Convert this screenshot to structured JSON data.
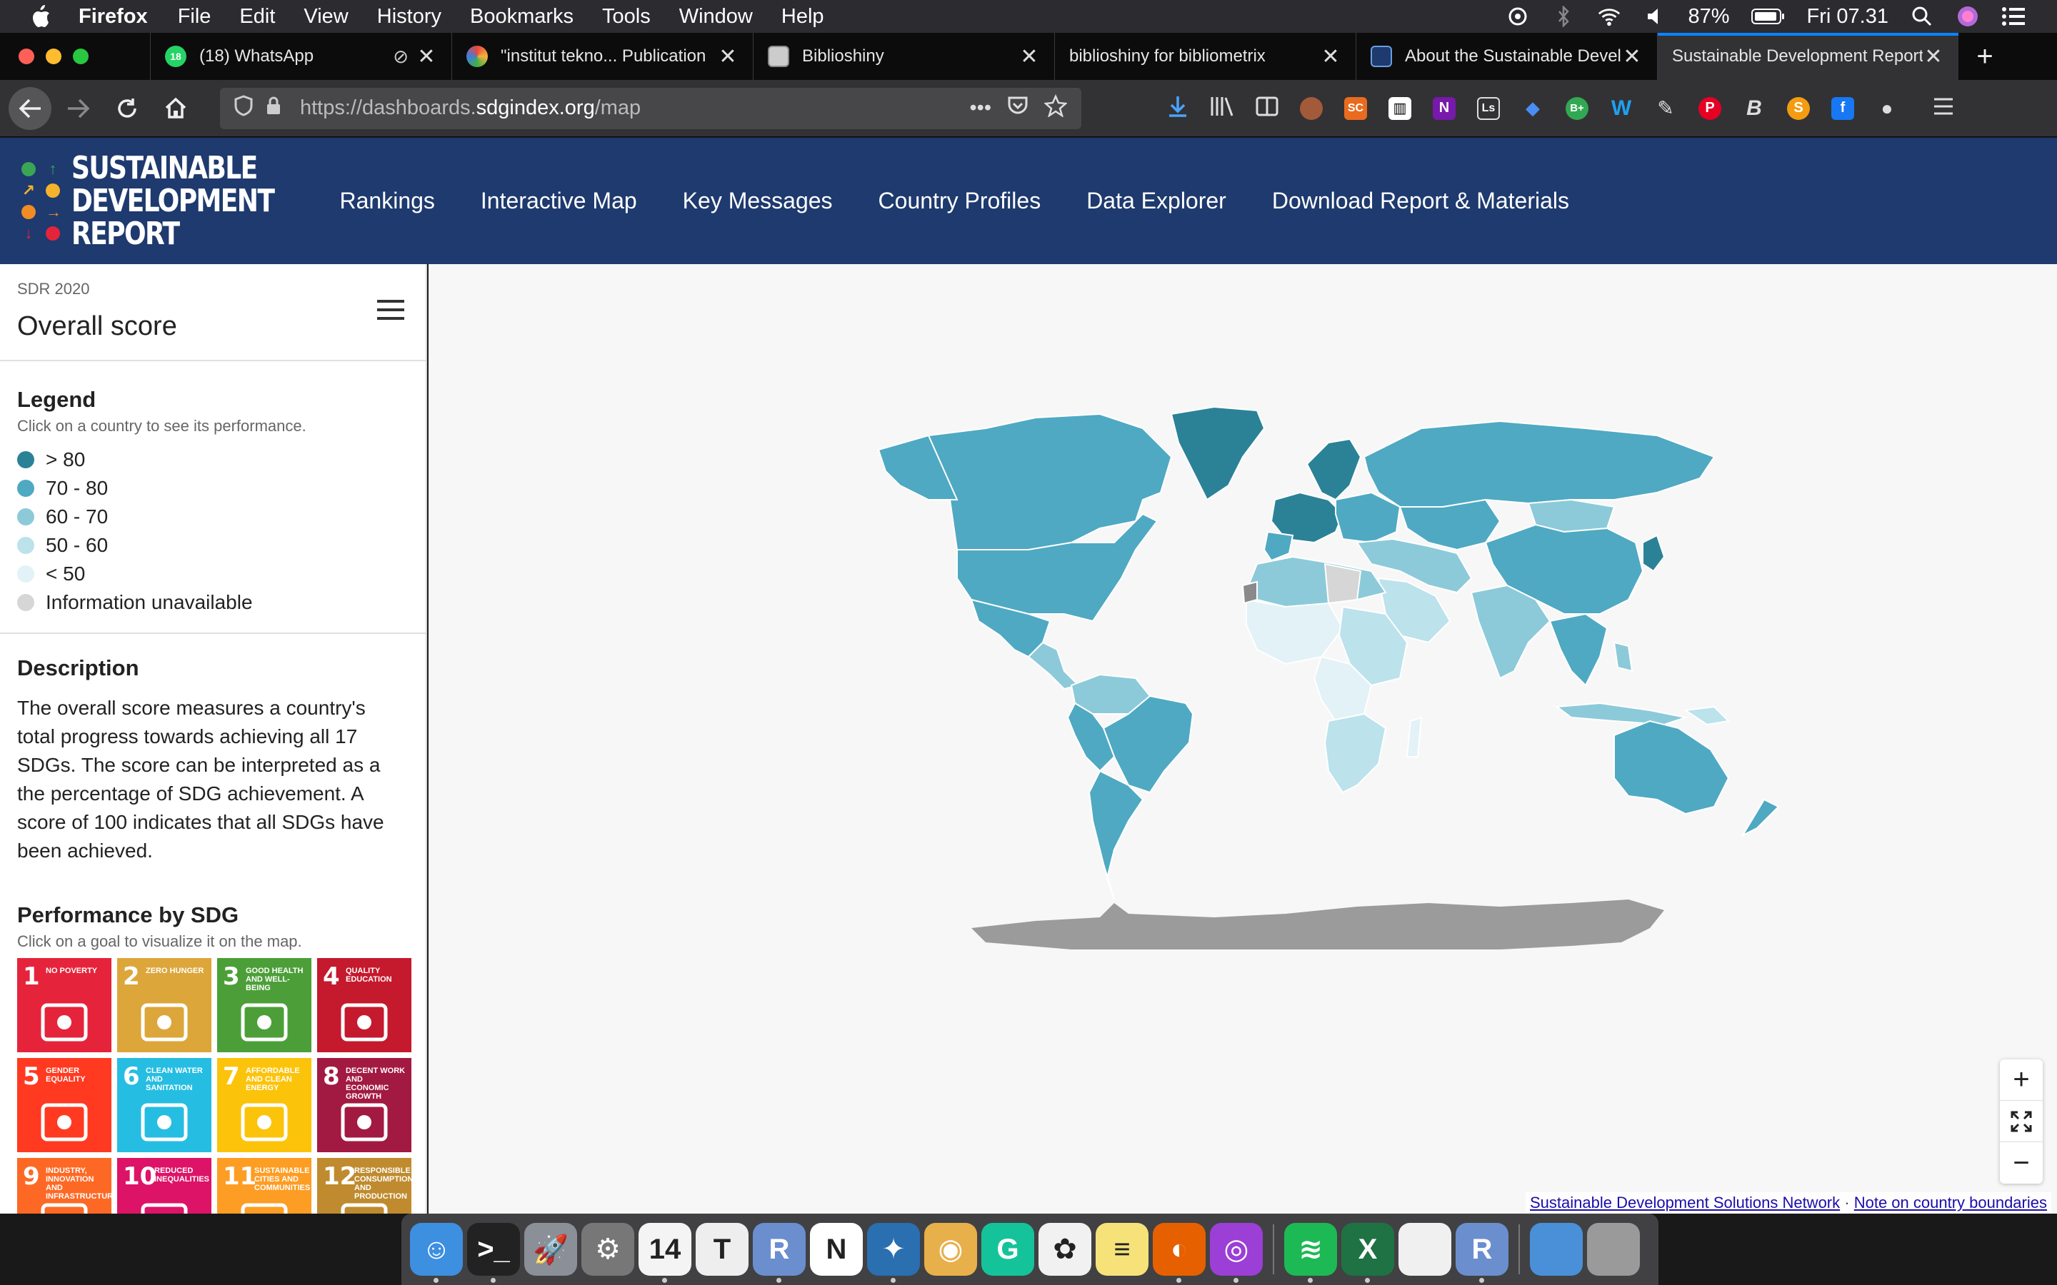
{
  "menubar": {
    "app": "Firefox",
    "items": [
      "File",
      "Edit",
      "View",
      "History",
      "Bookmarks",
      "Tools",
      "Window",
      "Help"
    ],
    "battery": "87%",
    "clock": "Fri 07.31"
  },
  "tabs": [
    {
      "title": "(18) WhatsApp",
      "icon": "whatsapp-icon",
      "badge": "18"
    },
    {
      "title": "\"institut tekno... Publication",
      "icon": "dimensions-icon"
    },
    {
      "title": "Biblioshiny",
      "icon": "biblioshiny-icon"
    },
    {
      "title": "biblioshiny for bibliometrix",
      "icon": ""
    },
    {
      "title": "About the Sustainable Development",
      "icon": "sdr-icon"
    },
    {
      "title": "Sustainable Development Report",
      "icon": ""
    }
  ],
  "toolbar": {
    "url_prefix": "https://dashboards.",
    "url_domain": "sdgindex.org",
    "url_path": "/map",
    "more_label": "•••"
  },
  "site": {
    "logo_lines": [
      "SUSTAINABLE",
      "DEVELOPMENT",
      "REPORT"
    ],
    "nav": [
      "Rankings",
      "Interactive Map",
      "Key Messages",
      "Country Profiles",
      "Data Explorer",
      "Download Report & Materials"
    ]
  },
  "sidebar": {
    "edition": "SDR 2020",
    "title": "Overall score",
    "legend_title": "Legend",
    "legend_hint": "Click on a country to see its performance.",
    "legend": [
      {
        "label": "> 80",
        "color": "#2b8296"
      },
      {
        "label": "70 - 80",
        "color": "#4fa9c2"
      },
      {
        "label": "60 - 70",
        "color": "#8ccad9"
      },
      {
        "label": "50 - 60",
        "color": "#bce2ec"
      },
      {
        "label": "< 50",
        "color": "#e2f2f7"
      },
      {
        "label": "Information unavailable",
        "color": "#d6d6d6"
      }
    ],
    "description_title": "Description",
    "description": "The overall score measures a country's total progress towards achieving all 17 SDGs. The score can be interpreted as a the percentage of SDG achievement. A score of 100 indicates that all SDGs have been achieved.",
    "perf_title": "Performance by SDG",
    "perf_hint": "Click on a goal to visualize it on the map.",
    "sdgs": [
      {
        "num": "1",
        "label": "NO POVERTY",
        "color": "#e5243b"
      },
      {
        "num": "2",
        "label": "ZERO HUNGER",
        "color": "#dda63a"
      },
      {
        "num": "3",
        "label": "GOOD HEALTH AND WELL-BEING",
        "color": "#4c9f38"
      },
      {
        "num": "4",
        "label": "QUALITY EDUCATION",
        "color": "#c5192d"
      },
      {
        "num": "5",
        "label": "GENDER EQUALITY",
        "color": "#ff3a21"
      },
      {
        "num": "6",
        "label": "CLEAN WATER AND SANITATION",
        "color": "#26bde2"
      },
      {
        "num": "7",
        "label": "AFFORDABLE AND CLEAN ENERGY",
        "color": "#fcc30b"
      },
      {
        "num": "8",
        "label": "DECENT WORK AND ECONOMIC GROWTH",
        "color": "#a21942"
      },
      {
        "num": "9",
        "label": "INDUSTRY, INNOVATION AND INFRASTRUCTURE",
        "color": "#fd6925"
      },
      {
        "num": "10",
        "label": "REDUCED INEQUALITIES",
        "color": "#dd1367"
      },
      {
        "num": "11",
        "label": "SUSTAINABLE CITIES AND COMMUNITIES",
        "color": "#fd9d24"
      },
      {
        "num": "12",
        "label": "RESPONSIBLE CONSUMPTION AND PRODUCTION",
        "color": "#bf8b2e"
      }
    ]
  },
  "map": {
    "attribution_1": "Sustainable Development Solutions Network",
    "attribution_sep": "·",
    "attribution_2": "Note on country boundaries",
    "zoom_in": "+",
    "zoom_out": "−"
  },
  "dock": [
    {
      "name": "finder-icon",
      "color": "#3d8fe0",
      "glyph": "☺"
    },
    {
      "name": "terminal-icon",
      "color": "#222",
      "glyph": ">_"
    },
    {
      "name": "launchpad-icon",
      "color": "#8a8f98",
      "glyph": "🚀"
    },
    {
      "name": "system-preferences-icon",
      "color": "#777",
      "glyph": "⚙"
    },
    {
      "name": "calendar-icon",
      "color": "#f4f4f4",
      "glyph": "14"
    },
    {
      "name": "typora-icon",
      "color": "#eee",
      "glyph": "T"
    },
    {
      "name": "r-icon",
      "color": "#6b8ecf",
      "glyph": "R"
    },
    {
      "name": "notion-icon",
      "color": "#fff",
      "glyph": "N"
    },
    {
      "name": "vosviewer-icon",
      "color": "#2a6fb0",
      "glyph": "✦"
    },
    {
      "name": "owl-icon",
      "color": "#e8b04a",
      "glyph": "◉"
    },
    {
      "name": "grammarly-icon",
      "color": "#15c39a",
      "glyph": "G"
    },
    {
      "name": "photos-icon",
      "color": "#f1f1f1",
      "glyph": "✿"
    },
    {
      "name": "notes-icon",
      "color": "#f7e27a",
      "glyph": "≡"
    },
    {
      "name": "firefox-icon",
      "color": "#e66000",
      "glyph": "◐"
    },
    {
      "name": "podcasts-icon",
      "color": "#9b3fd6",
      "glyph": "◎"
    },
    {
      "name": "spotify-icon",
      "color": "#1db954",
      "glyph": "≋"
    },
    {
      "name": "excel-icon",
      "color": "#1f7244",
      "glyph": "X"
    },
    {
      "name": "document-icon",
      "color": "#f0f0f0",
      "glyph": ""
    },
    {
      "name": "r-icon",
      "color": "#6b8ecf",
      "glyph": "R"
    },
    {
      "name": "downloads-folder-icon",
      "color": "#4a90d9",
      "glyph": ""
    },
    {
      "name": "trash-icon",
      "color": "#9a9a9a",
      "glyph": ""
    }
  ]
}
